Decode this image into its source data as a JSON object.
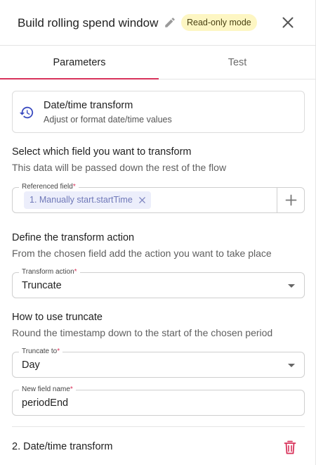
{
  "header": {
    "title": "Build rolling spend window",
    "mode_badge": "Read-only mode",
    "edit_icon": "pencil-icon",
    "close_icon": "close-icon"
  },
  "tabs": [
    {
      "label": "Parameters",
      "active": true
    },
    {
      "label": "Test",
      "active": false
    }
  ],
  "step": {
    "icon": "history-clock-icon",
    "title": "Date/time transform",
    "description": "Adjust or format date/time values"
  },
  "field_section": {
    "title": "Select which field you want to transform",
    "description": "This data will be passed down the rest of the flow",
    "referenced_field": {
      "label": "Referenced field",
      "required_mark": "*",
      "chip": "1. Manually start.startTime"
    }
  },
  "action_section": {
    "title": "Define the transform action",
    "description": "From the chosen field add the action you want to take place",
    "transform_action": {
      "label": "Transform action",
      "required_mark": "*",
      "value": "Truncate"
    }
  },
  "truncate_section": {
    "title": "How to use truncate",
    "description": "Round the timestamp down to the start of the chosen period",
    "truncate_to": {
      "label": "Truncate to",
      "required_mark": "*",
      "value": "Day"
    },
    "new_field_name": {
      "label": "New field name",
      "required_mark": "*",
      "value": "periodEnd"
    }
  },
  "next_step": {
    "title": "2. Date/time transform",
    "delete_icon": "trash-icon"
  },
  "colors": {
    "accent": "#d8335b",
    "badge_bg": "#fdf6c3",
    "chip_bg": "#eceefb",
    "chip_text": "#6f78b8",
    "step_icon": "#3b4cc0"
  }
}
